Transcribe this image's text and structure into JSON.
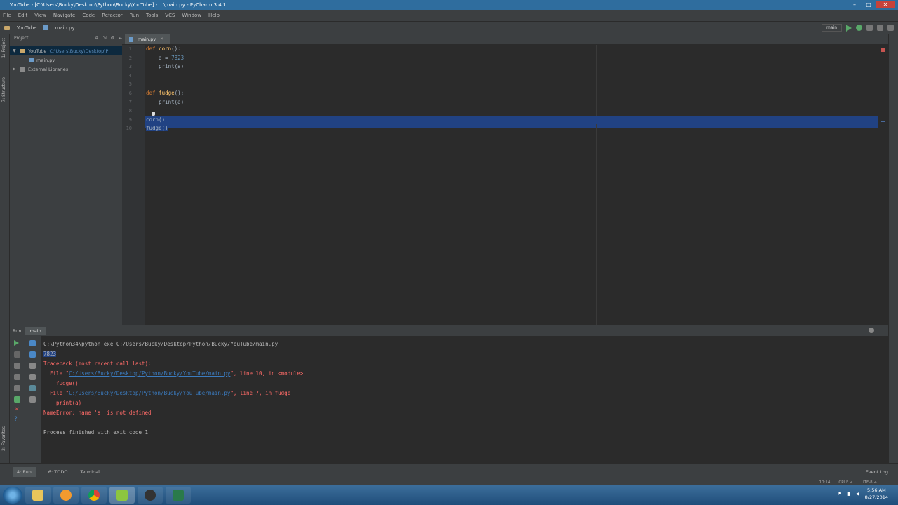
{
  "window": {
    "title": "YouTube - [C:\\Users\\Bucky\\Desktop\\Python\\Bucky\\YouTube] - ...\\main.py - PyCharm 3.4.1",
    "controls": [
      "–",
      "□",
      "✕"
    ]
  },
  "menu": [
    "File",
    "Edit",
    "View",
    "Navigate",
    "Code",
    "Refactor",
    "Run",
    "Tools",
    "VCS",
    "Window",
    "Help"
  ],
  "navbar": {
    "crumbs": [
      "YouTube",
      "main.py"
    ],
    "run_config": "main"
  },
  "sidebar_tabs": [
    "1: Project",
    "7: Structure",
    "2: Favorites"
  ],
  "project_panel": {
    "view_label": "Project",
    "tree": [
      {
        "label": "YouTube",
        "path": "C:\\Users\\Bucky\\Desktop\\P"
      },
      {
        "label": "main.py"
      },
      {
        "label": "External Libraries"
      }
    ]
  },
  "editor": {
    "tab": "main.py",
    "line_numbers": [
      "1",
      "2",
      "3",
      "4",
      "5",
      "6",
      "7",
      "8",
      "9",
      "10"
    ]
  },
  "code": {
    "l1_kw": "def ",
    "l1_fn": "corn",
    "l1_rest": "():",
    "l2_a": "    a = ",
    "l2_num": "7823",
    "l3": "    print(a)",
    "l4": "",
    "l5": "",
    "l6_kw": "def ",
    "l6_fn": "fudge",
    "l6_rest": "():",
    "l7": "    print(a)",
    "l8": "",
    "l9": "corn()",
    "l10": "fudge()"
  },
  "run_panel": {
    "label": "Run",
    "tab": "main"
  },
  "console": {
    "cmd": "C:\\Python34\\python.exe C:/Users/Bucky/Desktop/Python/Bucky/YouTube/main.py",
    "output": "7823",
    "tb_head": "Traceback (most recent call last):",
    "f1_pre": "  File \"",
    "f1_link": "C:/Users/Bucky/Desktop/Python/Bucky/YouTube/main.py",
    "f1_post": "\", line 10, in <module>",
    "f1_code": "    fudge()",
    "f2_pre": "  File \"",
    "f2_link": "C:/Users/Bucky/Desktop/Python/Bucky/YouTube/main.py",
    "f2_post": "\", line 7, in fudge",
    "f2_code": "    print(a)",
    "error": "NameError: name 'a' is not defined",
    "blank": "",
    "exit": "Process finished with exit code 1"
  },
  "tool_windows": {
    "run": "4: Run",
    "todo": "6: TODO",
    "terminal": "Terminal",
    "event_log": "Event Log"
  },
  "status": {
    "position": "10:14",
    "line_sep": "CRLF ÷",
    "encoding": "UTF-8 ÷"
  },
  "taskbar": {
    "time": "5:56 AM",
    "date": "8/27/2014"
  },
  "colors": {
    "keyword": "#cc7832",
    "function": "#ffc66d",
    "number": "#6897bb",
    "selection": "#214283",
    "error": "#ff6b68"
  }
}
